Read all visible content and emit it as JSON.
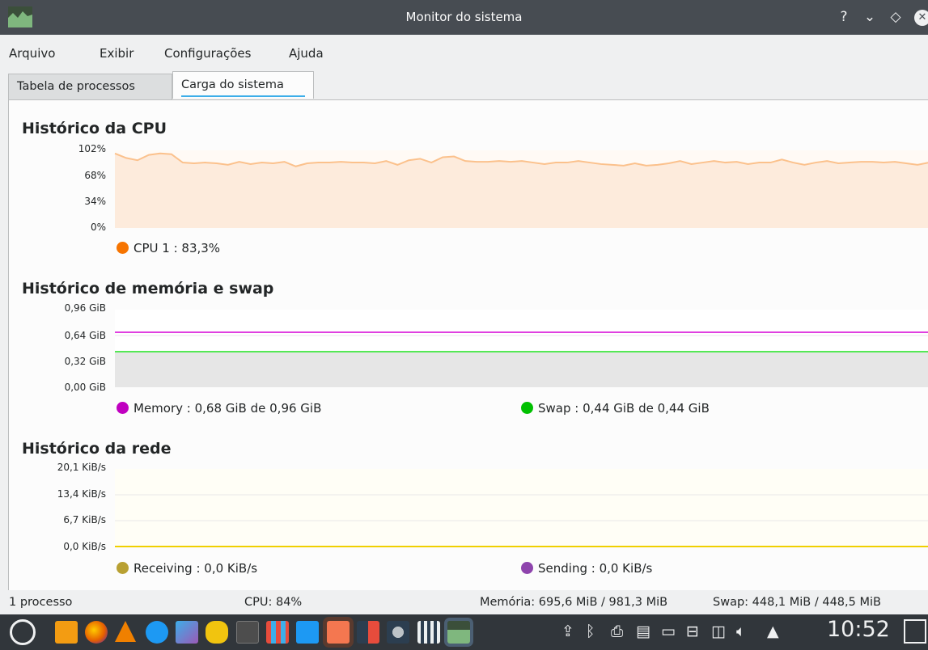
{
  "window": {
    "title": "Monitor do sistema",
    "buttons": {
      "help": "?",
      "minimize": "⌄",
      "maximize": "◇",
      "close": "✕"
    }
  },
  "menu": {
    "items": [
      "Arquivo",
      "Exibir",
      "Configurações",
      "Ajuda"
    ]
  },
  "tabs": [
    {
      "label": "Tabela de processos",
      "active": false
    },
    {
      "label": "Carga do sistema",
      "active": true
    }
  ],
  "cpu": {
    "title": "Histórico da CPU",
    "ticks": [
      "102%",
      "68%",
      "34%",
      "0%"
    ],
    "legend": [
      {
        "label": "CPU 1 : 83,3%",
        "color": "#f67400"
      }
    ]
  },
  "memory": {
    "title": "Histórico de memória e swap",
    "ticks": [
      "0,96 GiB",
      "0,64 GiB",
      "0,32 GiB",
      "0,00 GiB"
    ],
    "legend": [
      {
        "label": "Memory : 0,68 GiB de 0,96 GiB",
        "color": "#c000c0"
      },
      {
        "label": "Swap : 0,44 GiB de 0,44 GiB",
        "color": "#00c000"
      }
    ]
  },
  "network": {
    "title": "Histórico da rede",
    "ticks": [
      "20,1 KiB/s",
      "13,4 KiB/s",
      "6,7 KiB/s",
      "0,0 KiB/s"
    ],
    "legend": [
      {
        "label": "Receiving : 0,0 KiB/s",
        "color": "#b8a032"
      },
      {
        "label": "Sending : 0,0 KiB/s",
        "color": "#8e44ad"
      }
    ]
  },
  "status": {
    "processes": "1 processo",
    "cpu": "CPU: 84%",
    "memory": "Memória: 695,6 MiB / 981,3 MiB",
    "swap": "Swap: 448,1 MiB / 448,5 MiB"
  },
  "taskbar": {
    "clock": "10:52",
    "app_icons": [
      "kickoff-icon",
      "file-manager-icon",
      "firefox-icon",
      "vlc-icon",
      "audio-icon",
      "image-viewer-icon",
      "kde-hand-icon",
      "terminal-icon",
      "app-grid-icon",
      "documents-icon",
      "notes-icon",
      "music-icon",
      "tux-icon",
      "archive-icon",
      "system-monitor-icon"
    ]
  },
  "chart_data": [
    {
      "type": "area",
      "title": "Histórico da CPU",
      "ylim": [
        0,
        102
      ],
      "yticks": [
        "102%",
        "68%",
        "34%",
        "0%"
      ],
      "series": [
        {
          "name": "CPU 1",
          "color": "#f67400",
          "values": [
            98,
            92,
            89,
            96,
            98,
            97,
            86,
            85,
            86,
            85,
            83,
            87,
            84,
            86,
            85,
            87,
            81,
            85,
            86,
            86,
            87,
            86,
            86,
            85,
            88,
            83,
            89,
            91,
            86,
            93,
            94,
            88,
            87,
            87,
            88,
            87,
            88,
            86,
            84,
            86,
            86,
            88,
            86,
            84,
            83,
            82,
            85,
            82,
            83,
            85,
            88,
            84,
            86,
            88,
            86,
            87,
            84,
            86,
            86,
            90,
            86,
            83,
            86,
            88,
            85,
            86,
            87,
            87,
            86,
            87,
            85,
            83,
            86
          ]
        }
      ]
    },
    {
      "type": "line",
      "title": "Histórico de memória e swap",
      "ylim": [
        0,
        0.96
      ],
      "yticks": [
        "0,96 GiB",
        "0,64 GiB",
        "0,32 GiB",
        "0,00 GiB"
      ],
      "series": [
        {
          "name": "Memory",
          "color": "#e040e0",
          "values": [
            0.68,
            0.68
          ]
        },
        {
          "name": "Swap",
          "color": "#55e855",
          "values": [
            0.44,
            0.44
          ]
        }
      ]
    },
    {
      "type": "line",
      "title": "Histórico da rede",
      "ylim": [
        0,
        20.1
      ],
      "yticks": [
        "20,1 KiB/s",
        "13,4 KiB/s",
        "6,7 KiB/s",
        "0,0 KiB/s"
      ],
      "series": [
        {
          "name": "Receiving",
          "color": "#f0d000",
          "values": [
            0,
            0
          ]
        },
        {
          "name": "Sending",
          "color": "#8e44ad",
          "values": [
            0,
            0
          ]
        }
      ]
    }
  ]
}
